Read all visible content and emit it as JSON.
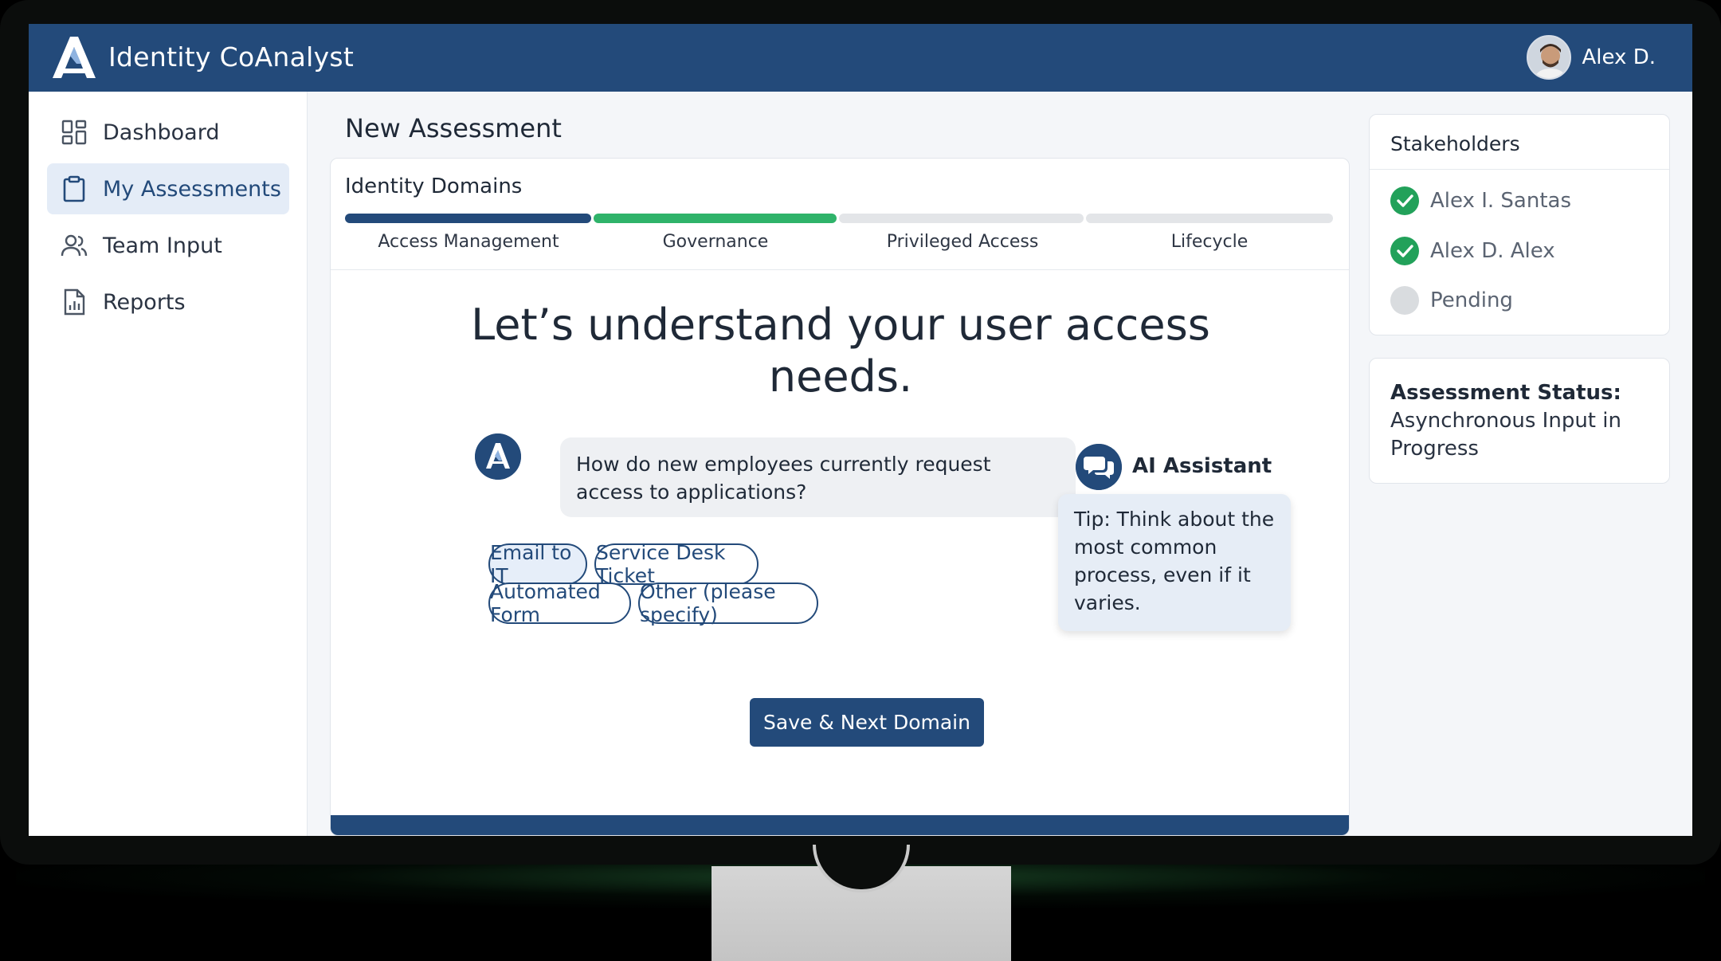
{
  "app": {
    "title": "Identity CoAnalyst"
  },
  "user": {
    "name": "Alex D."
  },
  "sidebar": {
    "items": [
      {
        "label": "Dashboard",
        "icon": "dashboard-icon",
        "active": false
      },
      {
        "label": "My Assessments",
        "icon": "clipboard-icon",
        "active": true
      },
      {
        "label": "Team Input",
        "icon": "users-icon",
        "active": false
      },
      {
        "label": "Reports",
        "icon": "report-icon",
        "active": false
      }
    ]
  },
  "page": {
    "title": "New Assessment"
  },
  "domains": {
    "title": "Identity Domains",
    "steps": [
      {
        "label": "Access Management",
        "status": "complete",
        "color": "#234a7a"
      },
      {
        "label": "Governance",
        "status": "current",
        "color": "#2fb36a"
      },
      {
        "label": "Privileged Access",
        "status": "pending",
        "color": "#e3e5e8"
      },
      {
        "label": "Lifecycle",
        "status": "pending",
        "color": "#e3e5e8"
      }
    ]
  },
  "main": {
    "headline": "Let’s understand your user access needs.",
    "question": "How do new employees currently request access to applications?",
    "options": [
      {
        "label": "Email to IT",
        "selected": true
      },
      {
        "label": "Service Desk Ticket",
        "selected": false
      },
      {
        "label": "Automated Form",
        "selected": false
      },
      {
        "label": "Other (please specify)",
        "selected": false
      }
    ],
    "save_label": "Save & Next Domain"
  },
  "assistant": {
    "label": "AI Assistant",
    "tip": "Tip: Think about the most common process, even if it varies."
  },
  "stakeholders": {
    "title": "Stakeholders",
    "items": [
      {
        "name": "Alex I. Santas",
        "status": "done"
      },
      {
        "name": "Alex D. Alex",
        "status": "done"
      },
      {
        "name": "Pending",
        "status": "pending"
      }
    ]
  },
  "status": {
    "label": "Assessment Status:",
    "value": "Asynchronous Input in Progress"
  },
  "colors": {
    "primary": "#234a7a",
    "success": "#22a15a",
    "progress_green": "#2fb36a"
  }
}
